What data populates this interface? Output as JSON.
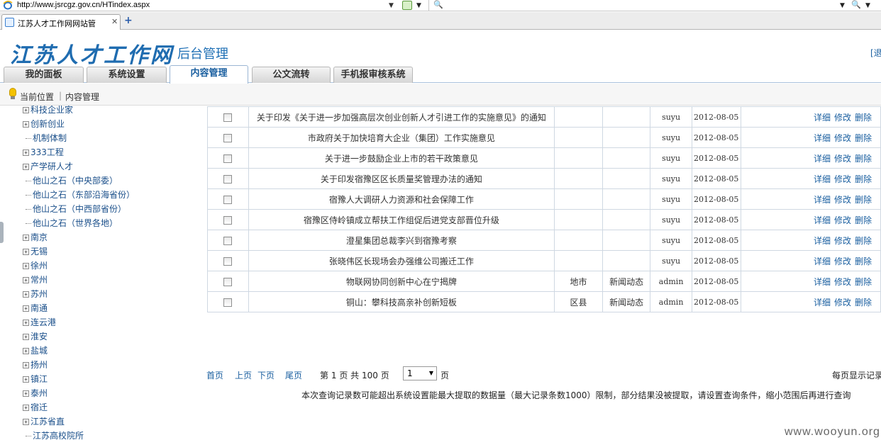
{
  "browser": {
    "url": "http://www.jsrcgz.gov.cn/HTindex.aspx",
    "tab_title": "江苏人才工作网网站管",
    "tab_close": "✕",
    "tab_new": "+"
  },
  "header": {
    "logo_text": "江苏人才工作网",
    "admin_title": "后台管理",
    "exit_text": "[退"
  },
  "nav": {
    "tabs": [
      {
        "label": "我的面板"
      },
      {
        "label": "系统设置"
      },
      {
        "label": "内容管理"
      },
      {
        "label": "公文流转"
      },
      {
        "label": "手机报审核系统"
      }
    ],
    "active_index": 2
  },
  "location": {
    "label": "当前位置",
    "separator": "|",
    "current": "内容管理"
  },
  "tree": {
    "items": [
      {
        "label": "科技企业家",
        "expandable": true
      },
      {
        "label": "创新创业",
        "expandable": true
      },
      {
        "label": "机制体制",
        "expandable": false
      },
      {
        "label": "333工程",
        "expandable": true
      },
      {
        "label": "产学研人才",
        "expandable": true
      },
      {
        "label": "他山之石（中央部委）",
        "expandable": false
      },
      {
        "label": "他山之石（东部沿海省份）",
        "expandable": false
      },
      {
        "label": "他山之石（中西部省份）",
        "expandable": false
      },
      {
        "label": "他山之石（世界各地）",
        "expandable": false
      },
      {
        "label": "南京",
        "expandable": true
      },
      {
        "label": "无锡",
        "expandable": true
      },
      {
        "label": "徐州",
        "expandable": true
      },
      {
        "label": "常州",
        "expandable": true
      },
      {
        "label": "苏州",
        "expandable": true
      },
      {
        "label": "南通",
        "expandable": true
      },
      {
        "label": "连云港",
        "expandable": true
      },
      {
        "label": "淮安",
        "expandable": true
      },
      {
        "label": "盐城",
        "expandable": true
      },
      {
        "label": "扬州",
        "expandable": true
      },
      {
        "label": "镇江",
        "expandable": true
      },
      {
        "label": "泰州",
        "expandable": true
      },
      {
        "label": "宿迁",
        "expandable": true
      },
      {
        "label": "江苏省直",
        "expandable": true
      },
      {
        "label": "江苏高校院所",
        "expandable": false
      }
    ]
  },
  "table": {
    "ops": {
      "detail": "详细",
      "edit": "修改",
      "delete": "删除"
    },
    "rows": [
      {
        "title": "关于印发《关于进一步加强高层次创业创新人才引进工作的实施意见》的通知",
        "category": "",
        "column": "",
        "user": "suyu",
        "date": "2012-08-05"
      },
      {
        "title": "市政府关于加快培育大企业（集团）工作实施意见",
        "category": "",
        "column": "",
        "user": "suyu",
        "date": "2012-08-05"
      },
      {
        "title": "关于进一步鼓励企业上市的若干政策意见",
        "category": "",
        "column": "",
        "user": "suyu",
        "date": "2012-08-05"
      },
      {
        "title": "关于印发宿豫区区长质量奖管理办法的通知",
        "category": "",
        "column": "",
        "user": "suyu",
        "date": "2012-08-05"
      },
      {
        "title": "宿豫人大调研人力资源和社会保障工作",
        "category": "",
        "column": "",
        "user": "suyu",
        "date": "2012-08-05"
      },
      {
        "title": "宿豫区侍岭镇成立帮扶工作组促后进党支部晋位升级",
        "category": "",
        "column": "",
        "user": "suyu",
        "date": "2012-08-05"
      },
      {
        "title": "澄星集团总裁李兴到宿豫考察",
        "category": "",
        "column": "",
        "user": "suyu",
        "date": "2012-08-05"
      },
      {
        "title": "张晓伟区长现场会办强维公司搬迁工作",
        "category": "",
        "column": "",
        "user": "suyu",
        "date": "2012-08-05"
      },
      {
        "title": "物联网协同创新中心在宁揭牌",
        "category": "地市",
        "column": "新闻动态",
        "user": "admin",
        "date": "2012-08-05"
      },
      {
        "title": "铜山：攀科技高亲补创新短板",
        "category": "区县",
        "column": "新闻动态",
        "user": "admin",
        "date": "2012-08-05"
      }
    ]
  },
  "pager": {
    "first": "首页",
    "prev": "上页",
    "next": "下页",
    "last": "尾页",
    "page_info_prefix": "第",
    "current_page": "1",
    "page_info_mid": "页 共",
    "total_pages": "100",
    "page_info_suffix": "页",
    "select_value": "1",
    "select_suffix": "页",
    "per_page_text": "每页显示记录"
  },
  "notice": "本次查询记录数可能超出系统设置能最大提取的数据量（最大记录条数1000）限制，部分结果没被提取，请设置查询条件，缩小范围后再进行查询",
  "watermark": "www.wooyun.org",
  "colors": {
    "link": "#1a5fa0",
    "logo": "#1f6cb0",
    "grid_border": "#cfd8e2"
  }
}
